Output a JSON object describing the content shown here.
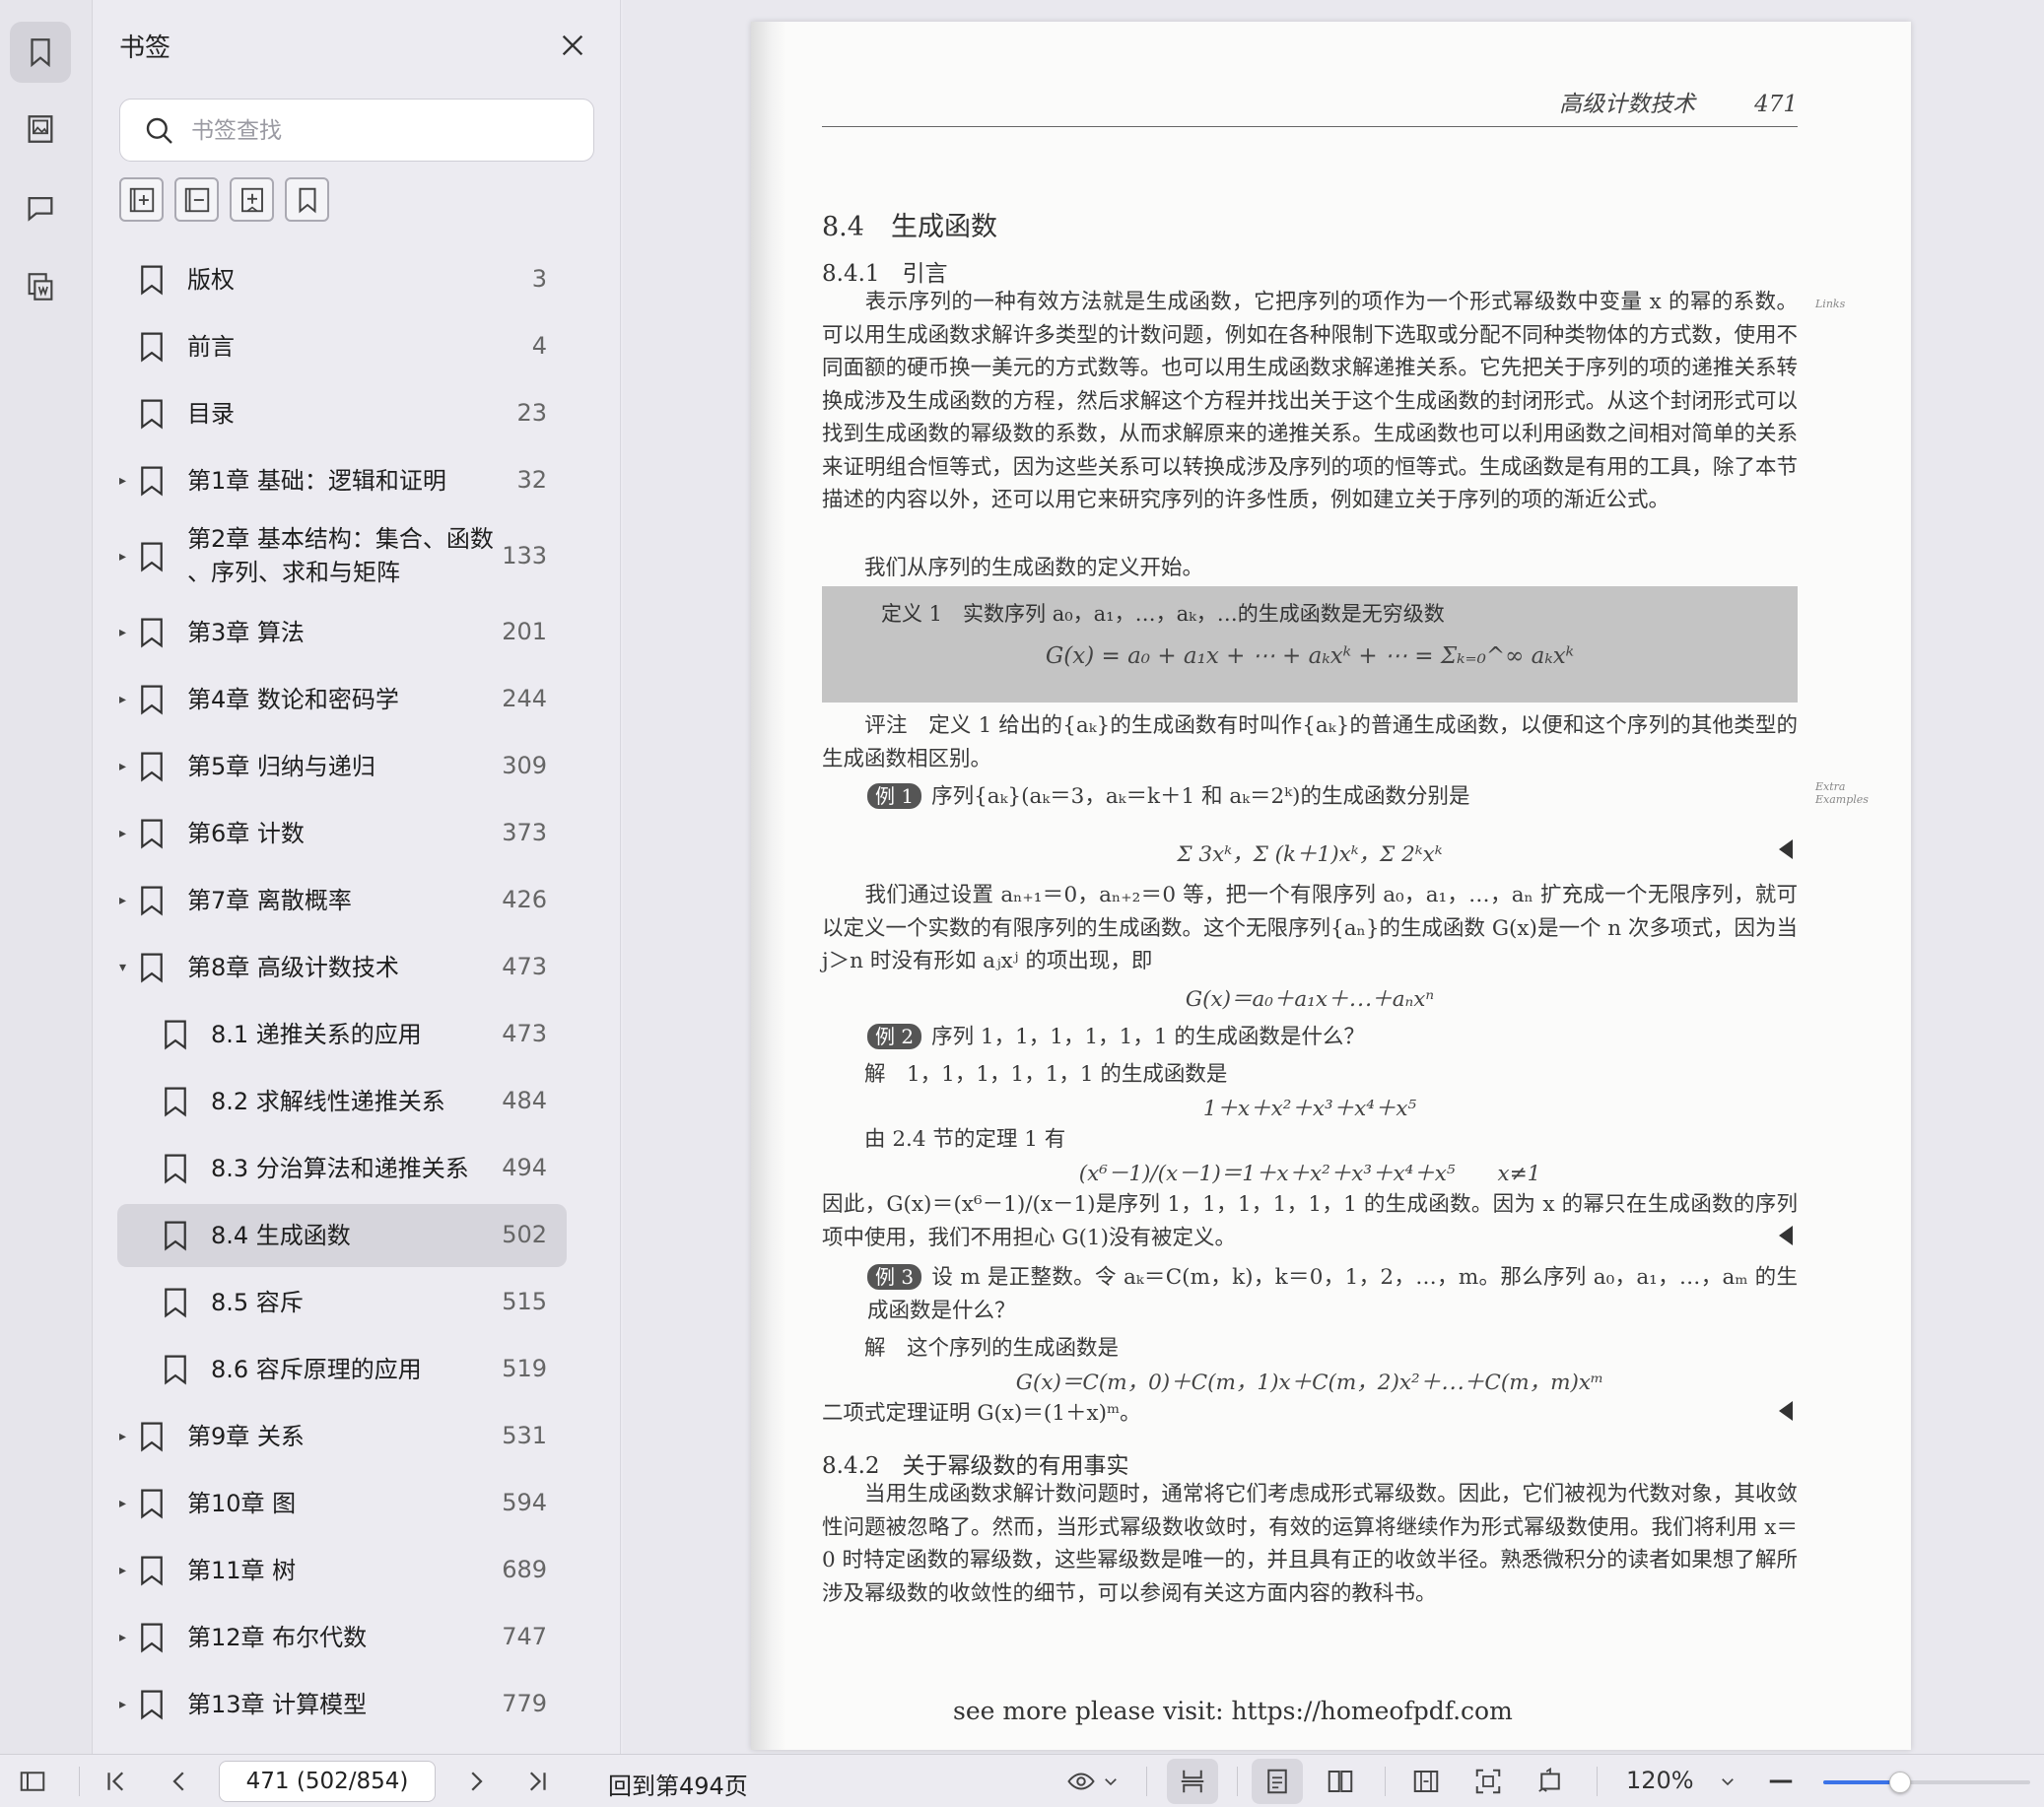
{
  "sidebar": {
    "title": "书签",
    "search_placeholder": "书签查找",
    "items": [
      {
        "label": "版权",
        "page": "3",
        "level": 0,
        "caret": ""
      },
      {
        "label": "前言",
        "page": "4",
        "level": 0,
        "caret": ""
      },
      {
        "label": "目录",
        "page": "23",
        "level": 0,
        "caret": ""
      },
      {
        "label": "第1章 基础：逻辑和证明",
        "page": "32",
        "level": 0,
        "caret": "▸"
      },
      {
        "label": "第2章 基本结构：集合、函数",
        "label2": "、序列、求和与矩阵",
        "page": "133",
        "level": 0,
        "caret": "▸"
      },
      {
        "label": "第3章 算法",
        "page": "201",
        "level": 0,
        "caret": "▸"
      },
      {
        "label": "第4章 数论和密码学",
        "page": "244",
        "level": 0,
        "caret": "▸"
      },
      {
        "label": "第5章 归纳与递归",
        "page": "309",
        "level": 0,
        "caret": "▸"
      },
      {
        "label": "第6章 计数",
        "page": "373",
        "level": 0,
        "caret": "▸"
      },
      {
        "label": "第7章 离散概率",
        "page": "426",
        "level": 0,
        "caret": "▸"
      },
      {
        "label": "第8章 高级计数技术",
        "page": "473",
        "level": 0,
        "caret": "▾"
      },
      {
        "label": "8.1 递推关系的应用",
        "page": "473",
        "level": 1,
        "caret": ""
      },
      {
        "label": "8.2 求解线性递推关系",
        "page": "484",
        "level": 1,
        "caret": ""
      },
      {
        "label": "8.3 分治算法和递推关系",
        "page": "494",
        "level": 1,
        "caret": ""
      },
      {
        "label": "8.4 生成函数",
        "page": "502",
        "level": 1,
        "caret": "",
        "selected": true
      },
      {
        "label": "8.5 容斥",
        "page": "515",
        "level": 1,
        "caret": ""
      },
      {
        "label": "8.6 容斥原理的应用",
        "page": "519",
        "level": 1,
        "caret": ""
      },
      {
        "label": "第9章 关系",
        "page": "531",
        "level": 0,
        "caret": "▸"
      },
      {
        "label": "第10章 图",
        "page": "594",
        "level": 0,
        "caret": "▸"
      },
      {
        "label": "第11章 树",
        "page": "689",
        "level": 0,
        "caret": "▸"
      },
      {
        "label": "第12章 布尔代数",
        "page": "747",
        "level": 0,
        "caret": "▸"
      },
      {
        "label": "第13章 计算模型",
        "page": "779",
        "level": 0,
        "caret": "▸"
      }
    ]
  },
  "document": {
    "running_head": "高级计数技术",
    "running_page": "471",
    "section_title": "8.4　生成函数",
    "subsection_1": "8.4.1　引言",
    "intro_para": "　　表示序列的一种有效方法就是生成函数，它把序列的项作为一个形式幂级数中变量 x 的幂的系数。可以用生成函数求解许多类型的计数问题，例如在各种限制下选取或分配不同种类物体的方式数，使用不同面额的硬币换一美元的方式数等。也可以用生成函数求解递推关系。它先把关于序列的项的递推关系转换成涉及生成函数的方程，然后求解这个方程并找出关于这个生成函数的封闭形式。从这个封闭形式可以找到生成函数的幂级数的系数，从而求解原来的递推关系。生成函数也可以利用函数之间相对简单的关系来证明组合恒等式，因为这些关系可以转换成涉及序列的项的恒等式。生成函数是有用的工具，除了本节描述的内容以外，还可以用它来研究序列的许多性质，例如建立关于序列的项的渐近公式。",
    "intro_para2": "　　我们从序列的生成函数的定义开始。",
    "def_head": "定义 1　实数序列 a₀，a₁，…，aₖ，…的生成函数是无穷级数",
    "def_formula": "G(x) = a₀ + a₁x + ⋯ + aₖxᵏ + ⋯ = Σₖ₌₀^∞ aₖxᵏ",
    "remark": "　　评注　定义 1 给出的{aₖ}的生成函数有时叫作{aₖ}的普通生成函数，以便和这个序列的其他类型的生成函数相区别。",
    "ex1_badge": "例 1",
    "ex1": "序列{aₖ}(aₖ＝3，aₖ＝k＋1 和 aₖ＝2ᵏ)的生成函数分别是",
    "ex1_formula": "Σ 3xᵏ，Σ (k＋1)xᵏ，Σ 2ᵏxᵏ",
    "para_finite": "　　我们通过设置 aₙ₊₁＝0，aₙ₊₂＝0 等，把一个有限序列 a₀，a₁，…，aₙ 扩充成一个无限序列，就可以定义一个实数的有限序列的生成函数。这个无限序列{aₙ}的生成函数 G(x)是一个 n 次多项式，因为当 j＞n 时没有形如 aⱼxʲ 的项出现，即",
    "formula_finite": "G(x)＝a₀＋a₁x＋⋯＋aₙxⁿ",
    "ex2_badge": "例 2",
    "ex2": "序列 1，1，1，1，1，1 的生成函数是什么？",
    "ex2_sol": "　　解　1，1，1，1，1，1 的生成函数是",
    "ex2_formula": "1＋x＋x²＋x³＋x⁴＋x⁵",
    "ex2_thm": "　　由 2.4 节的定理 1 有",
    "ex2_formula2": "(x⁶－1)/(x－1)＝1＋x＋x²＋x³＋x⁴＋x⁵　　x≠1",
    "ex2_concl": "因此，G(x)＝(x⁶－1)/(x－1)是序列 1，1，1，1，1，1 的生成函数。因为 x 的幂只在生成函数的序列项中使用，我们不用担心 G(1)没有被定义。",
    "ex3_badge": "例 3",
    "ex3": "设 m 是正整数。令 aₖ＝C(m，k)，k＝0，1，2，…，m。那么序列 a₀，a₁，…，aₘ 的生成函数是什么？",
    "ex3_sol": "　　解　这个序列的生成函数是",
    "ex3_formula": "G(x)＝C(m，0)＋C(m，1)x＋C(m，2)x²＋⋯＋C(m，m)xᵐ",
    "ex3_concl": "二项式定理证明 G(x)＝(1＋x)ᵐ。",
    "subsection_2": "8.4.2　关于幂级数的有用事实",
    "para_power": "　　当用生成函数求解计数问题时，通常将它们考虑成形式幂级数。因此，它们被视为代数对象，其收敛性问题被忽略了。然而，当形式幂级数收敛时，有效的运算将继续作为形式幂级数使用。我们将利用 x＝0 时特定函数的幂级数，这些幂级数是唯一的，并且具有正的收敛半径。熟悉微积分的读者如果想了解所涉及幂级数的收敛性的细节，可以参阅有关这方面内容的教科书。",
    "margin_links": "Links",
    "margin_extra": "Extra Examples",
    "watermark": "see more please visit: https://homeofpdf.com"
  },
  "toolbar": {
    "page_value": "471 (502/854)",
    "goto_label": "回到第494页",
    "zoom": "120%",
    "zoom_slider_fraction": 0.37
  }
}
